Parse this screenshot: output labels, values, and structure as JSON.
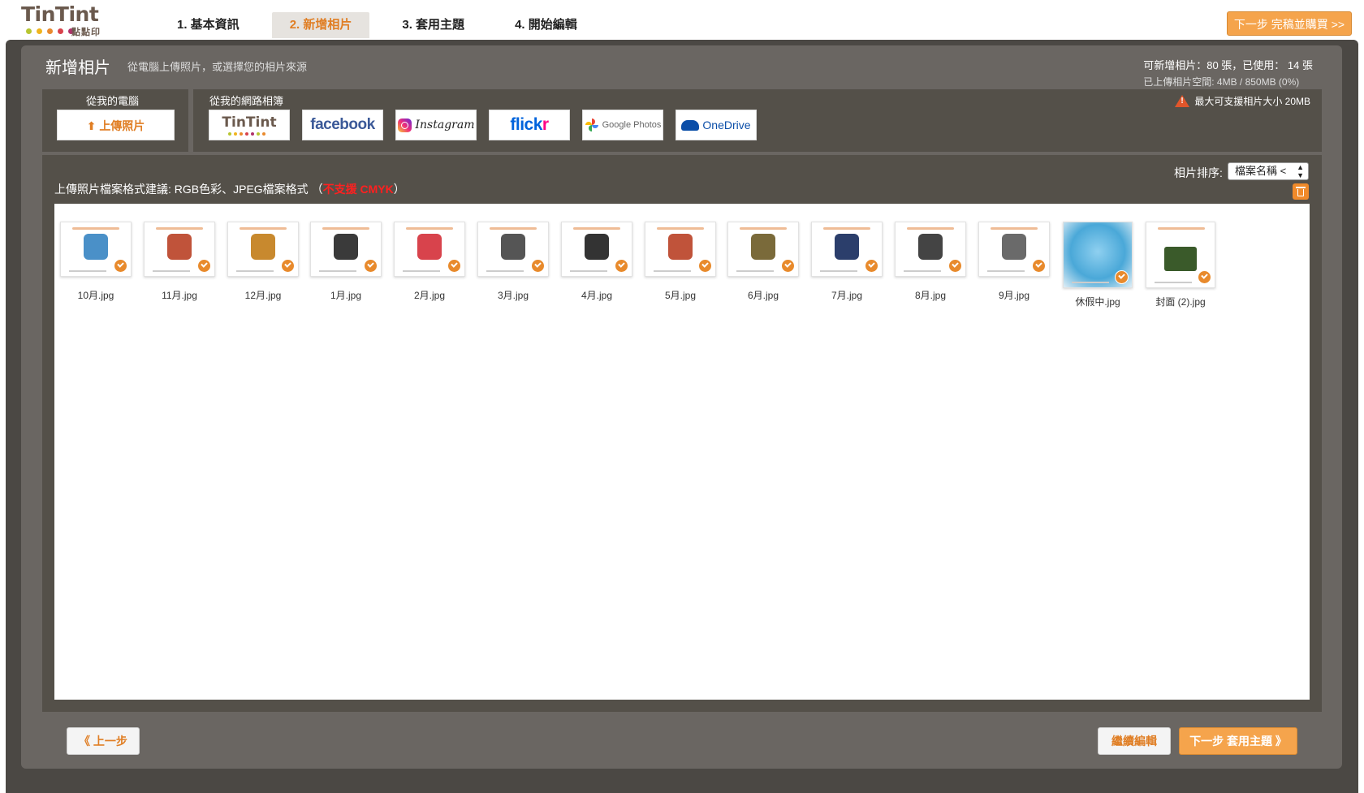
{
  "logo": {
    "text": "TinTint",
    "sub": "點點印",
    "dot_colors": [
      "#b7c531",
      "#f0b41e",
      "#e98a2e",
      "#d8434c",
      "#b0336b"
    ]
  },
  "steps": [
    {
      "label": "1. 基本資訊",
      "active": false
    },
    {
      "label": "2. 新增相片",
      "active": true
    },
    {
      "label": "3. 套用主題",
      "active": false
    },
    {
      "label": "4. 開始編輯",
      "active": false
    }
  ],
  "header": {
    "next_top_label": "下一步 完稿並購買 >>"
  },
  "page": {
    "title": "新增相片",
    "subtitle": "從電腦上傳照片，或選擇您的相片來源",
    "quota_line1": "可新增相片：80 張，已使用： 14 張",
    "quota_line2": "已上傳相片空間: 4MB / 850MB (0%)"
  },
  "sources": {
    "computer_label": "從我的電腦",
    "upload_label": "上傳照片",
    "web_label": "從我的網路相簿",
    "max_size": "最大可支援相片大小 20MB",
    "services": {
      "tintint": "TinTint",
      "facebook": "facebook",
      "instagram": "Instagram",
      "flickr_a": "flick",
      "flickr_b": "r",
      "google": "Google Photos",
      "onedrive": "OneDrive"
    }
  },
  "photos_panel": {
    "format_tip_prefix": "上傳照片檔案格式建議: RGB色彩、JPEG檔案格式  （",
    "format_tip_warn": "不支援 CMYK",
    "format_tip_suffix": "）",
    "sort_label": "相片排序:",
    "sort_value": "檔案名稱 <"
  },
  "photos": [
    {
      "name": "10月.jpg",
      "color": "#4a90c8"
    },
    {
      "name": "11月.jpg",
      "color": "#c0533a"
    },
    {
      "name": "12月.jpg",
      "color": "#c8892e"
    },
    {
      "name": "1月.jpg",
      "color": "#3a3a3a"
    },
    {
      "name": "2月.jpg",
      "color": "#d8434c"
    },
    {
      "name": "3月.jpg",
      "color": "#555555"
    },
    {
      "name": "4月.jpg",
      "color": "#333333"
    },
    {
      "name": "5月.jpg",
      "color": "#c0533a"
    },
    {
      "name": "6月.jpg",
      "color": "#7a6a3a"
    },
    {
      "name": "7月.jpg",
      "color": "#2b3e6b"
    },
    {
      "name": "8月.jpg",
      "color": "#444444"
    },
    {
      "name": "9月.jpg",
      "color": "#6a6a6a"
    },
    {
      "name": "休假中.jpg",
      "color": "#4aa8d8"
    },
    {
      "name": "封面 (2).jpg",
      "color": "#3a5a2a"
    }
  ],
  "footer": {
    "prev_label": "《 上一步",
    "continue_label": "繼續編輯",
    "next_label": "下一步 套用主題 》"
  }
}
